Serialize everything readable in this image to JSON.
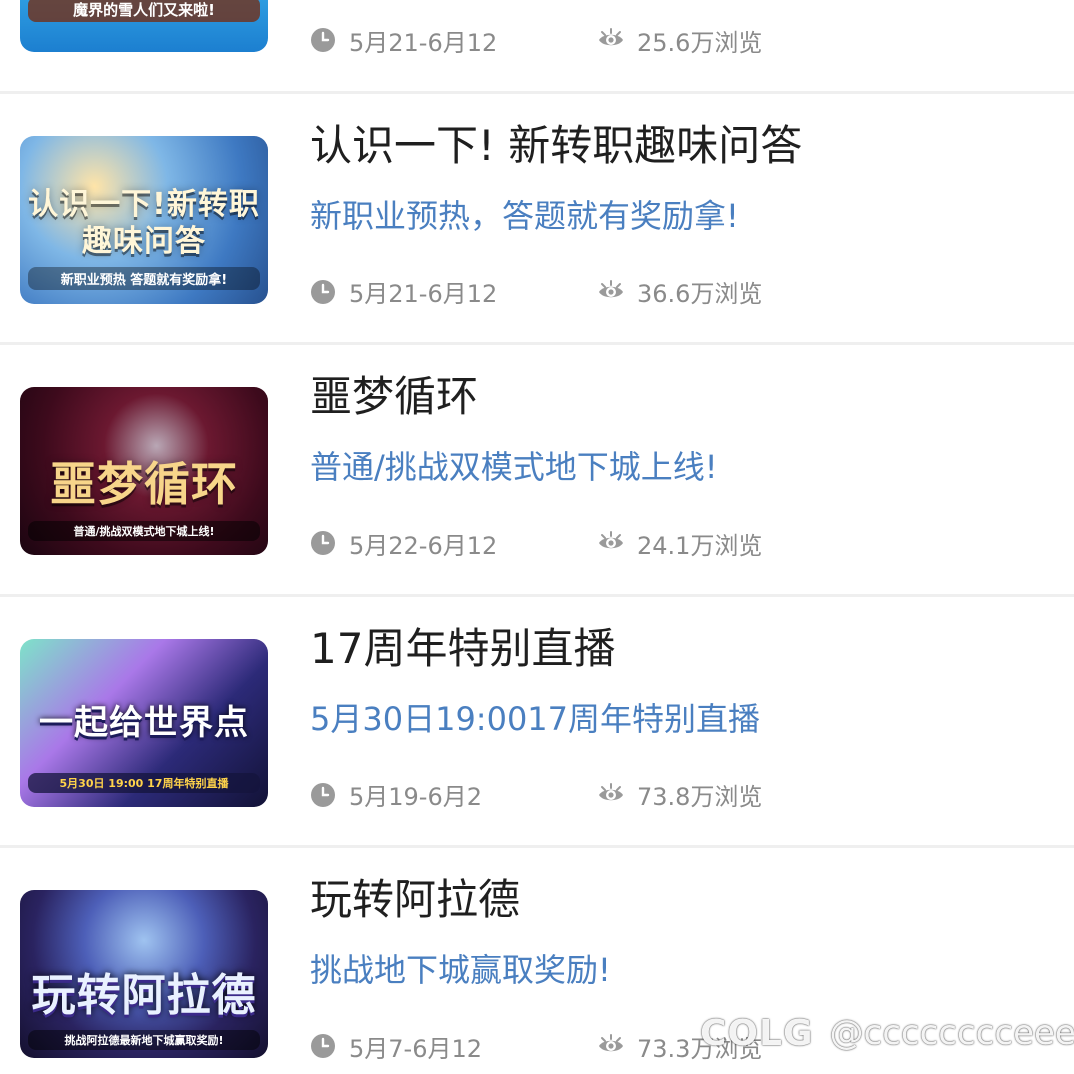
{
  "items": [
    {
      "banner_title": "",
      "banner_sub": "魔界的雪人们又来啦!",
      "title": "",
      "subtitle": "",
      "date": "5月21-6月12",
      "views": "25.6万浏览"
    },
    {
      "banner_title": "认识一下!新转职趣味问答",
      "banner_sub": "新职业预热 答题就有奖励拿!",
      "title": "认识一下! 新转职趣味问答",
      "subtitle": "新职业预热，答题就有奖励拿!",
      "date": "5月21-6月12",
      "views": "36.6万浏览"
    },
    {
      "banner_title": "噩梦循环",
      "banner_sub": "普通/挑战双模式地下城上线!",
      "title": "噩梦循环",
      "subtitle": "普通/挑战双模式地下城上线!",
      "date": "5月22-6月12",
      "views": "24.1万浏览"
    },
    {
      "banner_title": "一起给世界点",
      "banner_sub": "5月30日 19:00 17周年特别直播",
      "title": "17周年特别直播",
      "subtitle": "5月30日19:0017周年特别直播",
      "date": "5月19-6月2",
      "views": "73.8万浏览"
    },
    {
      "banner_title": "玩转阿拉德",
      "banner_sub": "挑战阿拉德最新地下城赢取奖励!",
      "title": "玩转阿拉德",
      "subtitle": "挑战地下城赢取奖励!",
      "date": "5月7-6月12",
      "views": "73.3万浏览"
    }
  ],
  "icons": {
    "date": "clock-icon",
    "views": "eye-icon"
  },
  "colors": {
    "subtitle": "#4a7fc0",
    "meta": "#8a8a8a",
    "divider": "#efefef"
  },
  "watermark": {
    "logo": "COLG",
    "handle": "@cccccccceee"
  }
}
